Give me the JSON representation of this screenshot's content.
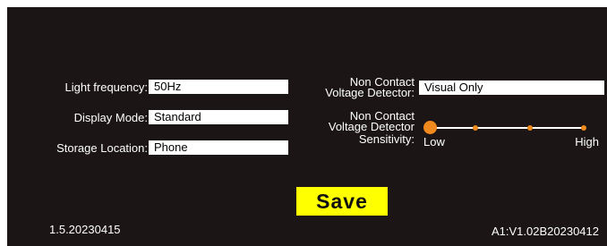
{
  "left_settings": {
    "light_frequency": {
      "label": "Light frequency:",
      "value": "50Hz"
    },
    "display_mode": {
      "label": "Display Mode:",
      "value": "Standard"
    },
    "storage_location": {
      "label": "Storage Location:",
      "value": "Phone"
    }
  },
  "right_settings": {
    "voltage_detector": {
      "label_line1": "Non Contact",
      "label_line2": "Voltage Detector:",
      "value": "Visual Only"
    },
    "sensitivity": {
      "label_line1": "Non Contact",
      "label_line2": "Voltage Detector",
      "label_line3": "Sensitivity:",
      "min_label": "Low",
      "max_label": "High",
      "level_fraction": 0,
      "steps": 4,
      "accent": "#f08a1e"
    }
  },
  "save_label": "Save",
  "version_left": "1.5.20230415",
  "version_right": "A1:V1.02B20230412",
  "colors": {
    "background": "#1b1515",
    "field": "#ffffff",
    "save_button": "#ffff00"
  }
}
